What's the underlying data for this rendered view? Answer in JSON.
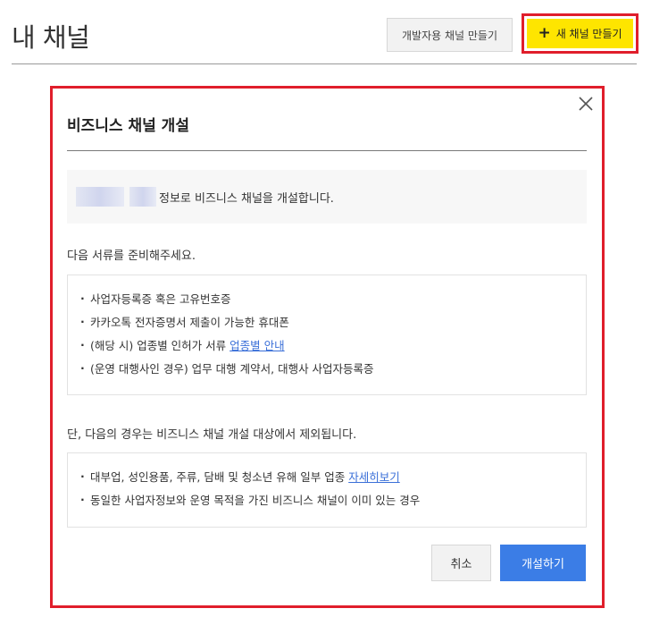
{
  "header": {
    "title": "내 채널",
    "dev_button_label": "개발자용 채널 만들기",
    "new_button_label": "새 채널 만들기"
  },
  "modal": {
    "title": "비즈니스 채널 개설",
    "info_text": "정보로 비즈니스 채널을 개설합니다.",
    "prepare_heading": "다음 서류를 준비해주세요.",
    "prepare_items": [
      "사업자등록증 혹은 고유번호증",
      "카카오톡 전자증명서 제출이 가능한 휴대폰",
      "(해당 시) 업종별 인허가 서류",
      "(운영 대행사인 경우) 업무 대행 계약서, 대행사 사업자등록증"
    ],
    "prepare_link": "업종별 안내",
    "exclude_heading": "단, 다음의 경우는 비즈니스 채널 개설 대상에서 제외됩니다.",
    "exclude_items": [
      "대부업, 성인용품, 주류, 담배 및 청소년 유해 일부 업종",
      "동일한 사업자정보와 운영 목적을 가진 비즈니스 채널이 이미 있는 경우"
    ],
    "exclude_link": "자세히보기",
    "cancel_label": "취소",
    "open_label": "개설하기"
  },
  "colors": {
    "accent_yellow": "#fee500",
    "primary_blue": "#3b7de6",
    "highlight_red": "#e01e2b",
    "link_blue": "#3a6fd8"
  }
}
